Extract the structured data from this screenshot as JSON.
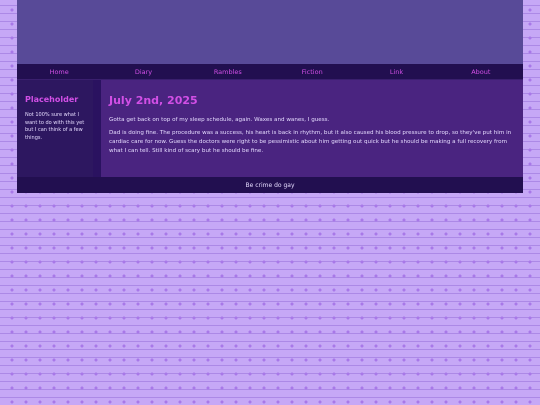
{
  "nav": {
    "items": [
      "Home",
      "Diary",
      "Rambles",
      "Fiction",
      "Link",
      "About"
    ]
  },
  "sidebar": {
    "title": "Placeholder",
    "text": "Not 100% sure what I want to do with this yet but I can think of a few things."
  },
  "post": {
    "title": "July 2nd, 2025",
    "paragraphs": [
      "Gotta get back on top of my sleep schedule, again. Waxes and wanes, I guess.",
      "Dad is doing fine. The procedure was a success, his heart is back in rhythm, but it also caused his blood pressure to drop, so they've put him in cardiac care for now. Guess the doctors were right to be pessimistic about him getting out quick but he should be making a full recovery from what I can tell. Still kind of scary but he should be fine."
    ]
  },
  "footer": {
    "text": "Be crime do gay"
  },
  "colors": {
    "accent": "#d24fe6",
    "header": "#584a98",
    "nav": "#220f50",
    "main": "#4a2480",
    "sidebar": "#2d1760",
    "background": "#c6a8f6"
  }
}
